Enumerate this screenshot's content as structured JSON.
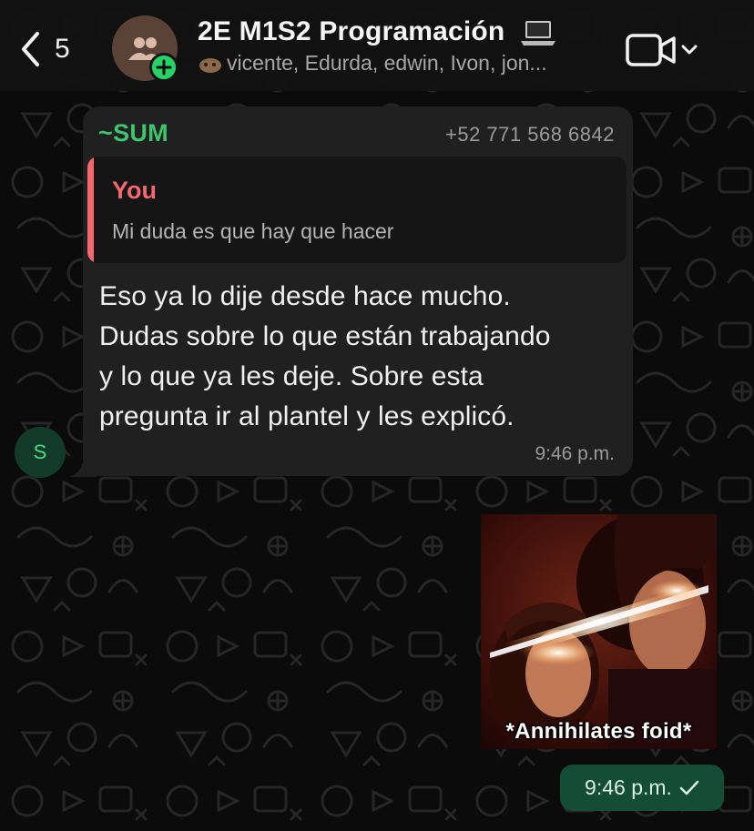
{
  "header": {
    "back_count": "5",
    "group_title": "2E M1S2 Programación",
    "members": "vicente, Edurda, edwin, Ivon, jon..."
  },
  "incoming_message": {
    "sender_name": "~SUM",
    "sender_phone": "+52 771 568 6842",
    "quoted_author": "You",
    "quoted_text": "Mi duda es que hay que hacer",
    "text": "Eso ya lo dije desde hace mucho.\nDudas sobre lo que están trabajando\ny lo que ya les deje. Sobre esta\npregunta ir al plantel y les explicó.",
    "time": "9:46 p.m.",
    "avatar_initial": "S"
  },
  "outgoing_image": {
    "caption": "*Annihilates foid*",
    "time": "9:46 p.m."
  },
  "colors": {
    "accent_green": "#25d366",
    "sender_name_green": "#3ec46d",
    "quote_pink": "#f3676f",
    "outgoing_bubble": "#134d37",
    "incoming_bubble": "#202020"
  },
  "icons": [
    "chevron-left-icon",
    "group-icon",
    "add-icon",
    "laptop-icon",
    "video-camera-icon",
    "chevron-down-icon",
    "check-icon"
  ]
}
